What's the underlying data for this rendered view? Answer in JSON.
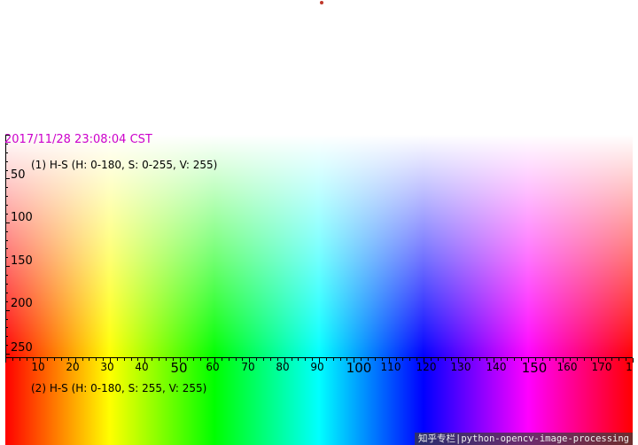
{
  "timestamp": "2017/11/28 23:08:04 CST",
  "captions": {
    "top": "(1) H-S (H: 0-180, S: 0-255, V: 255)",
    "bottom": "(2) H-S (H: 0-180, S: 255, V: 255)"
  },
  "watermark": "知乎专栏|python-opencv-image-processing",
  "axis": {
    "y_ticks": [
      "50",
      "100",
      "150",
      "200",
      "250"
    ],
    "x_ticks": [
      "10",
      "20",
      "30",
      "40",
      "50",
      "60",
      "70",
      "80",
      "90",
      "100",
      "110",
      "120",
      "130",
      "140",
      "150",
      "160",
      "170",
      "1"
    ]
  },
  "colors": {
    "timestamp": "#cc00cc",
    "marker": "#c0392b"
  }
}
